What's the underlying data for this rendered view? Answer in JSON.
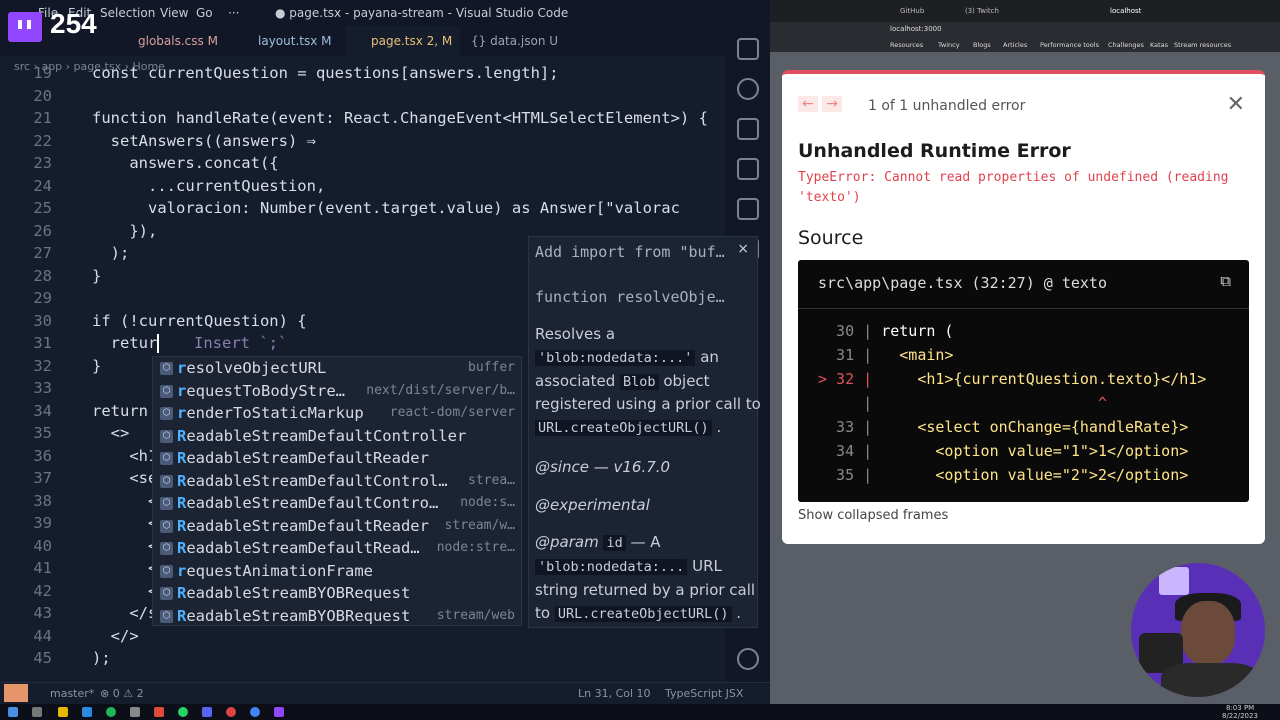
{
  "viewer_count": "254",
  "vscode": {
    "menu": [
      "File",
      "Edit",
      "Selection",
      "View",
      "Go",
      "···"
    ],
    "window_title": "● page.tsx - payana-stream - Visual Studio Code",
    "tabs": [
      {
        "label": "globals.css M",
        "color": "#d9a0a0"
      },
      {
        "label": "layout.tsx M",
        "color": "#9ac0d9"
      },
      {
        "label": "page.tsx 2, M",
        "color": "#e6c07b"
      },
      {
        "label": "{} data.json U",
        "color": "#e6c07b"
      }
    ],
    "breadcrumb": "src › app › page.tsx › Home",
    "code_lines": [
      {
        "n": "19",
        "t": "const currentQuestion = questions[answers.length];"
      },
      {
        "n": "20",
        "t": ""
      },
      {
        "n": "21",
        "t": "function handleRate(event: React.ChangeEvent<HTMLSelectElement>) {"
      },
      {
        "n": "22",
        "t": "  setAnswers((answers) ⇒"
      },
      {
        "n": "23",
        "t": "    answers.concat({"
      },
      {
        "n": "24",
        "t": "      ...currentQuestion,"
      },
      {
        "n": "25",
        "t": "      valoracion: Number(event.target.value) as Answer[\"valorac"
      },
      {
        "n": "26",
        "t": "    }),"
      },
      {
        "n": "27",
        "t": "  );"
      },
      {
        "n": "28",
        "t": "}"
      },
      {
        "n": "29",
        "t": ""
      },
      {
        "n": "30",
        "t": "if (!currentQuestion) {"
      },
      {
        "n": "31",
        "t": "  retur"
      },
      {
        "n": "32",
        "t": "}"
      },
      {
        "n": "33",
        "t": ""
      },
      {
        "n": "34",
        "t": "return ("
      },
      {
        "n": "35",
        "t": "  <>"
      },
      {
        "n": "36",
        "t": "    <h1"
      },
      {
        "n": "37",
        "t": "    <se"
      },
      {
        "n": "38",
        "t": "      <"
      },
      {
        "n": "39",
        "t": "      <"
      },
      {
        "n": "40",
        "t": "      <"
      },
      {
        "n": "41",
        "t": "      <"
      },
      {
        "n": "42",
        "t": "      <"
      },
      {
        "n": "43",
        "t": "    </s"
      },
      {
        "n": "44",
        "t": "  </>"
      },
      {
        "n": "45",
        "t": ");"
      }
    ],
    "inline_hint": "Insert `;`",
    "suggestions": [
      {
        "pre": "r",
        "label": "esolveObjectURL",
        "detail": "buffer"
      },
      {
        "pre": "r",
        "label": "equestToBodyStre…",
        "detail": "next/dist/server/b…"
      },
      {
        "pre": "r",
        "label": "enderToStaticMarkup",
        "detail": "react-dom/server"
      },
      {
        "pre": "R",
        "label": "eadableStreamDefaultController",
        "detail": ""
      },
      {
        "pre": "R",
        "label": "eadableStreamDefaultReader",
        "detail": ""
      },
      {
        "pre": "R",
        "label": "eadableStreamDefaultControl…",
        "detail": "strea…"
      },
      {
        "pre": "R",
        "label": "eadableStreamDefaultContro…",
        "detail": "node:s…"
      },
      {
        "pre": "R",
        "label": "eadableStreamDefaultReader",
        "detail": "stream/w…"
      },
      {
        "pre": "R",
        "label": "eadableStreamDefaultRead…",
        "detail": "node:stre…"
      },
      {
        "pre": "r",
        "label": "equestAnimationFrame",
        "detail": ""
      },
      {
        "pre": "R",
        "label": "eadableStreamBYOBRequest",
        "detail": ""
      },
      {
        "pre": "R",
        "label": "eadableStreamBYOBRequest",
        "detail": "stream/web"
      }
    ],
    "hover": {
      "import_line": "Add import from \"buf…",
      "signature": "function resolveObje…",
      "desc1": "Resolves a",
      "code1": "'blob:nodedata:...'",
      "desc1b": "an",
      "desc2": "associated",
      "code2": "Blob",
      "desc2b": "object",
      "desc3": "registered using a prior call to",
      "code3": "URL.createObjectURL()",
      "since": "@since — v16.7.0",
      "experimental": "@experimental",
      "param": "@param",
      "param_id": "id",
      "param_desc": "— A",
      "code4": "'blob:nodedata:...",
      "desc4b": "URL",
      "desc5": "string returned by a prior call",
      "desc6": "to",
      "code5": "URL.createObjectURL()"
    },
    "status": {
      "branch": "master*",
      "problems": "⊗ 0 ⚠ 2",
      "position": "Ln 31, Col 10",
      "language": "TypeScript JSX"
    }
  },
  "browser": {
    "url": "localhost:3000",
    "tabs": [
      "GitHub",
      "(3) Twitch",
      "localhost"
    ],
    "bookmarks": [
      "Resources",
      "Twincy",
      "Blogs",
      "Articles",
      "Performance tools",
      "Challenges",
      "Katas",
      "Stream resources"
    ],
    "error": {
      "count_text": "1 of 1 unhandled error",
      "title": "Unhandled Runtime Error",
      "message": "TypeError: Cannot read properties of undefined (reading 'texto')",
      "source_heading": "Source",
      "file": "src\\app\\page.tsx (32:27) @ texto",
      "lines": [
        {
          "n": "  30 |",
          "t": "return (",
          "kind": "plain"
        },
        {
          "n": "  31 |",
          "t": "  <main>",
          "kind": "tag"
        },
        {
          "n": "> 32 |",
          "t": "    <h1>{currentQuestion.texto}</h1>",
          "kind": "err"
        },
        {
          "n": "     |",
          "t": "                        ^",
          "kind": "caret"
        },
        {
          "n": "  33 |",
          "t": "    <select onChange={handleRate}>",
          "kind": "tag"
        },
        {
          "n": "  34 |",
          "t": "      <option value=\"1\">1</option>",
          "kind": "tag"
        },
        {
          "n": "  35 |",
          "t": "      <option value=\"2\">2</option>",
          "kind": "tag"
        }
      ],
      "show_collapsed": "Show collapsed frames"
    }
  },
  "taskbar": {
    "time": "8:03 PM",
    "date": "8/22/2023"
  }
}
